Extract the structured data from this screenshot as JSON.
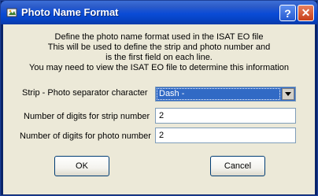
{
  "window": {
    "title": "Photo Name Format",
    "help_label": "?",
    "close_label": "✕"
  },
  "description": [
    "Define the photo name format used in the ISAT EO file",
    "This will be used to define the strip and photo number and",
    "is the first field on each line.",
    "You may need to view the ISAT EO file to determine this information"
  ],
  "separator": {
    "label": "Strip - Photo separator character",
    "value": "Dash -"
  },
  "strip_digits": {
    "label": "Number of digits for strip number",
    "value": "2"
  },
  "photo_digits": {
    "label": "Number of digits for photo number",
    "value": "2"
  },
  "buttons": {
    "ok": "OK",
    "cancel": "Cancel"
  }
}
